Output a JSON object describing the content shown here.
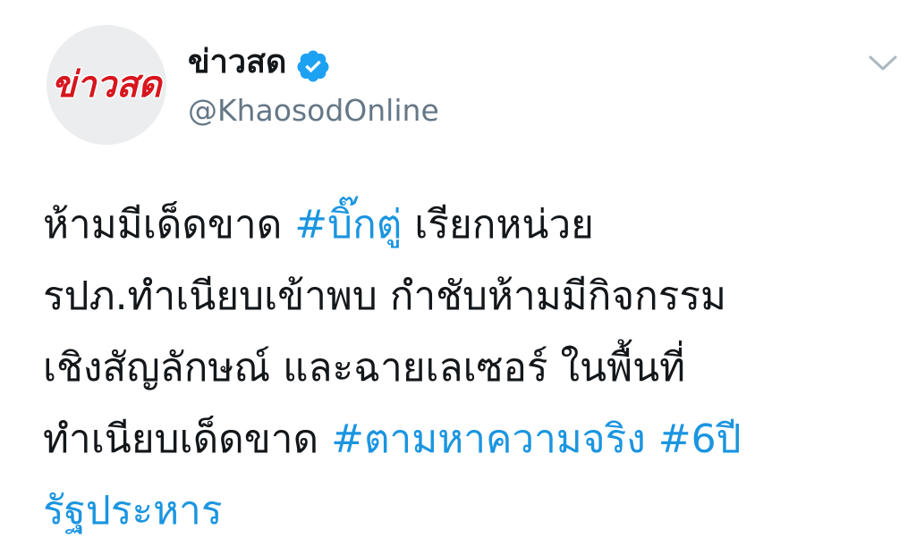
{
  "account": {
    "display_name": "ข่าวสด",
    "handle": "@KhaosodOnline",
    "verified": true,
    "avatar_logo_text": "ข่าวสด"
  },
  "tweet": {
    "line1": {
      "t1": "ห้ามมีเด็ดขาด ",
      "tag1": "#บิ๊กตู่",
      "t2": " เรียกหน่วย"
    },
    "line2": "รปภ.ทำเนียบเข้าพบ กำชับห้ามมีกิจกรรม",
    "line3": "เชิงสัญลักษณ์ และฉายเลเซอร์ ในพื้นที่",
    "line4": {
      "t1": "ทำเนียบเด็ดขาด ",
      "tag1": "#ตามหาความจริง",
      "t2": " ",
      "tag2": "#6ปี"
    },
    "line5": {
      "tag2_cont": "รัฐประหาร"
    }
  },
  "colors": {
    "hashtag": "#1b95e0",
    "verified": "#1da1f2",
    "logo_red": "#d6161e",
    "muted": "#657786"
  },
  "icons": {
    "verified": "verified-badge-icon",
    "menu": "chevron-down-icon"
  }
}
